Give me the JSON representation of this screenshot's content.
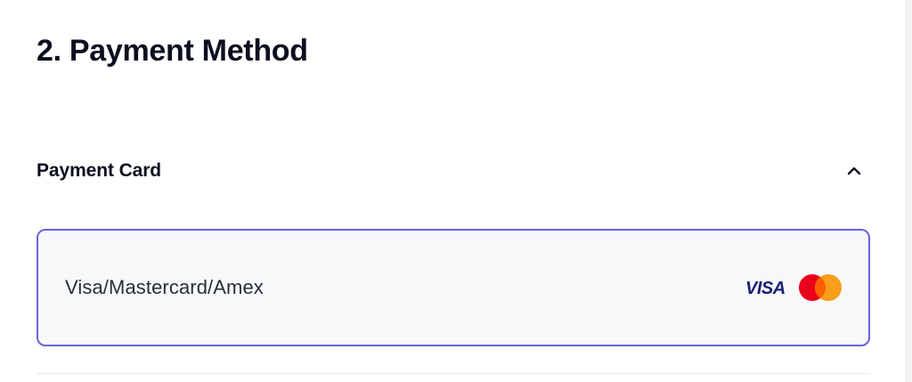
{
  "section": {
    "title": "2. Payment Method"
  },
  "accordion": {
    "title": "Payment Card",
    "expanded": true,
    "toggle_icon": "chevron-up-icon"
  },
  "payment_option": {
    "label": "Visa/Mastercard/Amex",
    "selected": true,
    "logos": {
      "visa_text": "VISA",
      "visa_color": "#1a1f71",
      "mastercard_left_color": "#eb001b",
      "mastercard_right_color": "#f79e1b",
      "mastercard_icon": "mastercard-logo"
    },
    "border_color": "#6a62e4"
  }
}
